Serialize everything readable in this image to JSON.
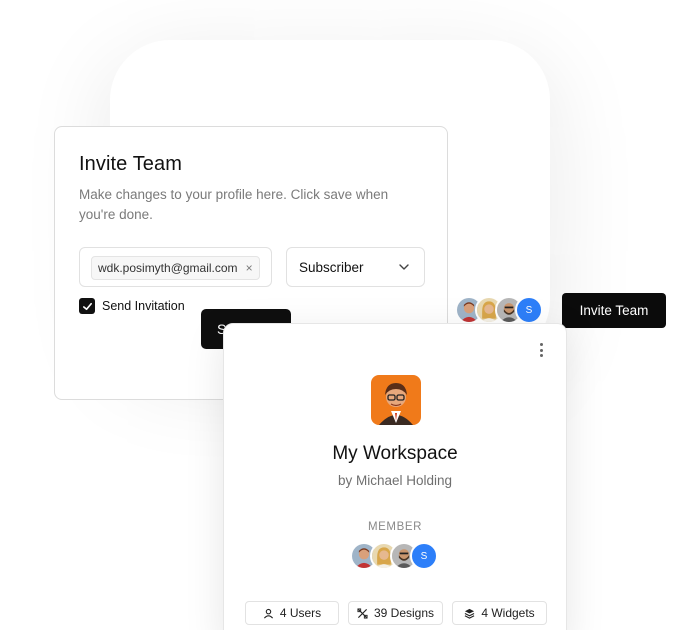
{
  "invite_card": {
    "title": "Invite Team",
    "description": "Make changes to your profile here. Click save when you're done.",
    "email_chip": "wdk.posimyth@gmail.com",
    "chip_remove": "×",
    "role_value": "Subscriber",
    "send_invitation_label": "Send Invitation",
    "send_invitation_checked": true,
    "save_button_partial": "S"
  },
  "team_avatars": {
    "avatars": [
      "person-red",
      "person-blonde",
      "person-beard"
    ],
    "initial": "S",
    "initial_color": "#2d7ff9"
  },
  "invite_team_button": "Invite Team",
  "workspace_card": {
    "title": "My Workspace",
    "owner": "by Michael Holding",
    "member_label": "MEMBER",
    "member_initial": "S",
    "stats": {
      "users": "4 Users",
      "designs": "39 Designs",
      "widgets": "4 Widgets"
    }
  },
  "colors": {
    "dark_button": "#0f0f0f",
    "accent_blue": "#2d7ff9",
    "logo_orange": "#f07a1a"
  }
}
